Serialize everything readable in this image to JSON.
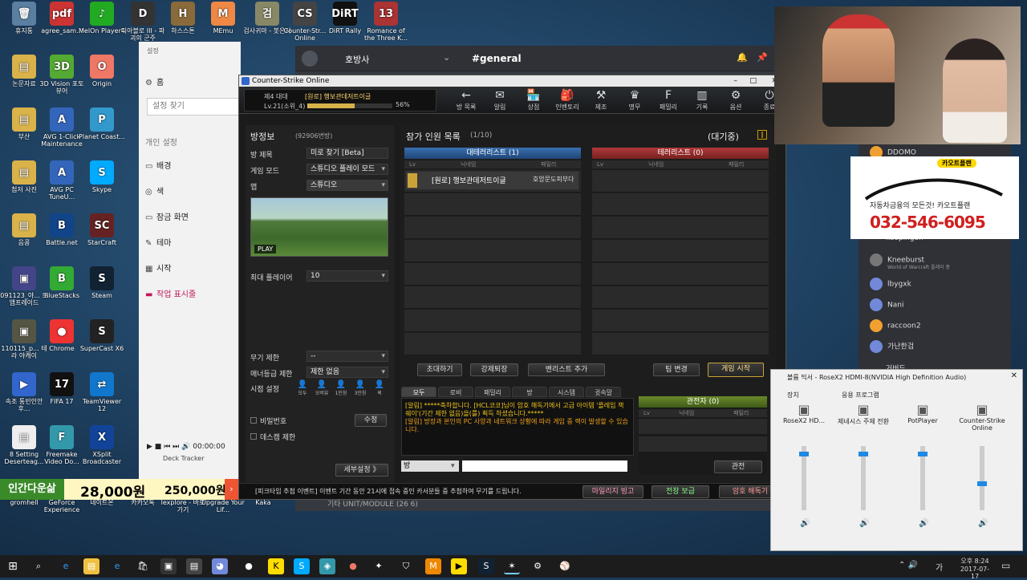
{
  "desktop_icons": [
    {
      "label": "휴지통",
      "color": "#5a7fa0",
      "glyph": "🗑"
    },
    {
      "label": "agree_sam...",
      "color": "#c33",
      "glyph": "pdf"
    },
    {
      "label": "MelOn Player4",
      "color": "#2a2",
      "glyph": "♪"
    },
    {
      "label": "디아블로 III - 파괴의 군주",
      "color": "#333",
      "glyph": "D"
    },
    {
      "label": "하스스톤",
      "color": "#8a6a3a",
      "glyph": "H"
    },
    {
      "label": "MEmu",
      "color": "#e84",
      "glyph": "M"
    },
    {
      "label": "검사귀마 - 봇은사",
      "color": "#886",
      "glyph": "검"
    },
    {
      "label": "Counter-Str... Online",
      "color": "#444",
      "glyph": "CS"
    },
    {
      "label": "DiRT Rally",
      "color": "#111",
      "glyph": "DiRT"
    },
    {
      "label": "Romance of the Three K...",
      "color": "#a33",
      "glyph": "13"
    },
    {
      "label": "논문자료",
      "color": "#d9b24a",
      "glyph": "▤"
    },
    {
      "label": "3D Vision 포토 뷰어",
      "color": "#5a3",
      "glyph": "3D"
    },
    {
      "label": "Origin",
      "color": "#e76",
      "glyph": "O"
    },
    {
      "label": "부산",
      "color": "#d9b24a",
      "glyph": "▤"
    },
    {
      "label": "AVG 1-Click Maintenance",
      "color": "#36b",
      "glyph": "A"
    },
    {
      "label": "Planet Coast...",
      "color": "#39c",
      "glyph": "P"
    },
    {
      "label": "첨저 사진",
      "color": "#d9b24a",
      "glyph": "▤"
    },
    {
      "label": "AVG PC TuneU...",
      "color": "#36b",
      "glyph": "A"
    },
    {
      "label": "Skype",
      "color": "#0af",
      "glyph": "S"
    },
    {
      "label": "음콩",
      "color": "#d9b24a",
      "glyph": "▤"
    },
    {
      "label": "Battle.net",
      "color": "#148",
      "glyph": "B"
    },
    {
      "label": "StarCraft",
      "color": "#622",
      "glyph": "SC"
    },
    {
      "label": "091123_야... 드앱프레이드",
      "color": "#448",
      "glyph": "▣"
    },
    {
      "label": "BlueStacks",
      "color": "#3a3",
      "glyph": "B"
    },
    {
      "label": "Steam",
      "color": "#123",
      "glyph": "S"
    },
    {
      "label": "110115_p... 테라 야캐이",
      "color": "#554",
      "glyph": "▣"
    },
    {
      "label": "Chrome",
      "color": "#e33",
      "glyph": "●"
    },
    {
      "label": "SuperCast X6",
      "color": "#222",
      "glyph": "S"
    },
    {
      "label": "속조 통빈인안후...",
      "color": "#36c",
      "glyph": "▶"
    },
    {
      "label": "FIFA 17",
      "color": "#111",
      "glyph": "17"
    },
    {
      "label": "TeamViewer 12",
      "color": "#17c",
      "glyph": "⇄"
    },
    {
      "label": "8 Setting Deserteag...",
      "color": "#eee",
      "glyph": "▤"
    },
    {
      "label": "Freemake Video Do...",
      "color": "#39a",
      "glyph": "F"
    },
    {
      "label": "XSplit Broadcaster",
      "color": "#149",
      "glyph": "X"
    },
    {
      "label": "gromhell",
      "color": "#555",
      "glyph": "g"
    },
    {
      "label": "GeForce Experience",
      "color": "#3a3",
      "glyph": "G"
    },
    {
      "label": "네이트온",
      "color": "#3a9",
      "glyph": "N"
    },
    {
      "label": "카카오톡",
      "color": "#fd0",
      "glyph": "K"
    },
    {
      "label": "lexplore - 바로 가기",
      "color": "#36c",
      "glyph": "e"
    },
    {
      "label": "Upgrade Your Lif...",
      "color": "#2a6",
      "glyph": "U"
    },
    {
      "label": "Kaka",
      "color": "#fd0",
      "glyph": "K"
    }
  ],
  "settings": {
    "title": "설정",
    "home": "홈",
    "search_placeholder": "설정 찾기",
    "section": "개인 설정",
    "items": [
      "배경",
      "색",
      "잠금 화면",
      "테마",
      "시작",
      "작업 표시줄"
    ]
  },
  "discord": {
    "server": "호방사",
    "channel": "#general",
    "members": [
      "DDOMO",
      "keepingon",
      "Kneeburst",
      "lbygxk",
      "Nani",
      "raccoon2",
      "가난한검",
      "거버드"
    ],
    "member_sub": "World of Warcraft 플레이 중",
    "bottom_item": "기타 UNIT/MODULE (26 6)"
  },
  "cso": {
    "window_title": "Counter-Strike Online",
    "user_rank": "제4 대대",
    "user_clan": "[원로] 행보관데저트이글",
    "user_level": "Lv.21(소위_4)",
    "exp": "56%",
    "exp_fraction": 0.56,
    "top_buttons": [
      {
        "icon": "←",
        "label": "방 목록"
      },
      {
        "icon": "✉",
        "label": "알림"
      },
      {
        "icon": "🏪",
        "label": "상점"
      },
      {
        "icon": "🎒",
        "label": "인벤토리"
      },
      {
        "icon": "⚒",
        "label": "제조"
      },
      {
        "icon": "♛",
        "label": "명무"
      },
      {
        "icon": "F",
        "label": "패밀리"
      },
      {
        "icon": "▥",
        "label": "기록"
      },
      {
        "icon": "⚙",
        "label": "옵션"
      },
      {
        "icon": "⏻",
        "label": "종료"
      }
    ],
    "room": {
      "heading": "방정보",
      "room_no": "(92906번방)",
      "title_label": "방 제목",
      "title_value": "미로 찾기 [Beta]",
      "mode_label": "게임 모드",
      "mode_value": "스튜디오 플레이 모드",
      "map_label": "맵",
      "map_value": "스튜디오",
      "play": "PLAY",
      "max_label": "최대 플레이어",
      "max_value": "10",
      "weapon_label": "무기 제한",
      "weapon_value": "--",
      "manner_label": "매너등급 제한",
      "manner_value": "제한 없음",
      "view_label": "시점 설정",
      "view_options": [
        "모두",
        "오버뷰",
        "1인칭",
        "3인칭",
        "퀵"
      ],
      "password": "비밀번호",
      "modify": "수정",
      "deathcam": "데스캠 제한",
      "detail": "세부설정 》"
    },
    "participants": {
      "heading": "참가 인원 목록",
      "count": "(1/10)",
      "status": "(대기중)",
      "ct_team": "대테러리스트 (1)",
      "t_team": "테러리스트 (0)",
      "cols": [
        "Lv",
        "닉네임",
        "패밀리"
      ],
      "player_name": "[원로] 행보관데저트이글",
      "player_family": "호앙문도피부다",
      "buttons": [
        "초대하기",
        "강제퇴장",
        "밴리스트 추가",
        "팀 변경",
        "게임 시작"
      ]
    },
    "chat": {
      "tabs": [
        "모두",
        "로비",
        "패밀리",
        "방",
        "시스템",
        "귓속말"
      ],
      "messages": [
        "[알림] *****축하합니다. [HCL코코]님이 암호 해독기에서 고급 아이템 '플레임 책 쉐이'(기간 제한 없음)을(를) 획득 하셨습니다.*****",
        "[알림] 방장과 본인의 PC 사양과 네트워크 상황에 따라 게임 중 랙이 발생할 수 있습니다."
      ],
      "channel": "방",
      "observer": "관전자 (0)",
      "observe_btn": "관전"
    },
    "ticker": "[피크타임 추첨 이벤트] 이벤트 기간 동안 21시에 접속 중인 카서분들 중 추첨하여 무기를 드립니다.",
    "bottom_buttons": [
      "마일리지 빙고",
      "전장 보급",
      "암호 해독기"
    ]
  },
  "ad": {
    "brand": "카오트플랜",
    "slogan": "자동차금융의 모든것! 카오트플랜",
    "phone": "032-546-6095"
  },
  "promo": {
    "title": "인간다운삶",
    "price1": "28,000원",
    "price2": "250,000원"
  },
  "media": {
    "time": "00:00:00",
    "label": "Deck Tracker"
  },
  "audio": {
    "title": "볼륨 믹서 - RoseX2 HDMI-8(NVIDIA High Definition Audio)",
    "device_label": "장치",
    "apps_label": "응용 프로그램",
    "channels": [
      {
        "name": "RoseX2 HD...",
        "level": 0.9
      },
      {
        "name": "제네시스 주제 전환",
        "level": 0.9
      },
      {
        "name": "PotPlayer",
        "level": 0.9
      },
      {
        "name": "Counter-Strike Online",
        "level": 0.4
      }
    ]
  },
  "tray": {
    "ime": "가",
    "time": "오후 8:24",
    "date": "2017-07-17"
  }
}
